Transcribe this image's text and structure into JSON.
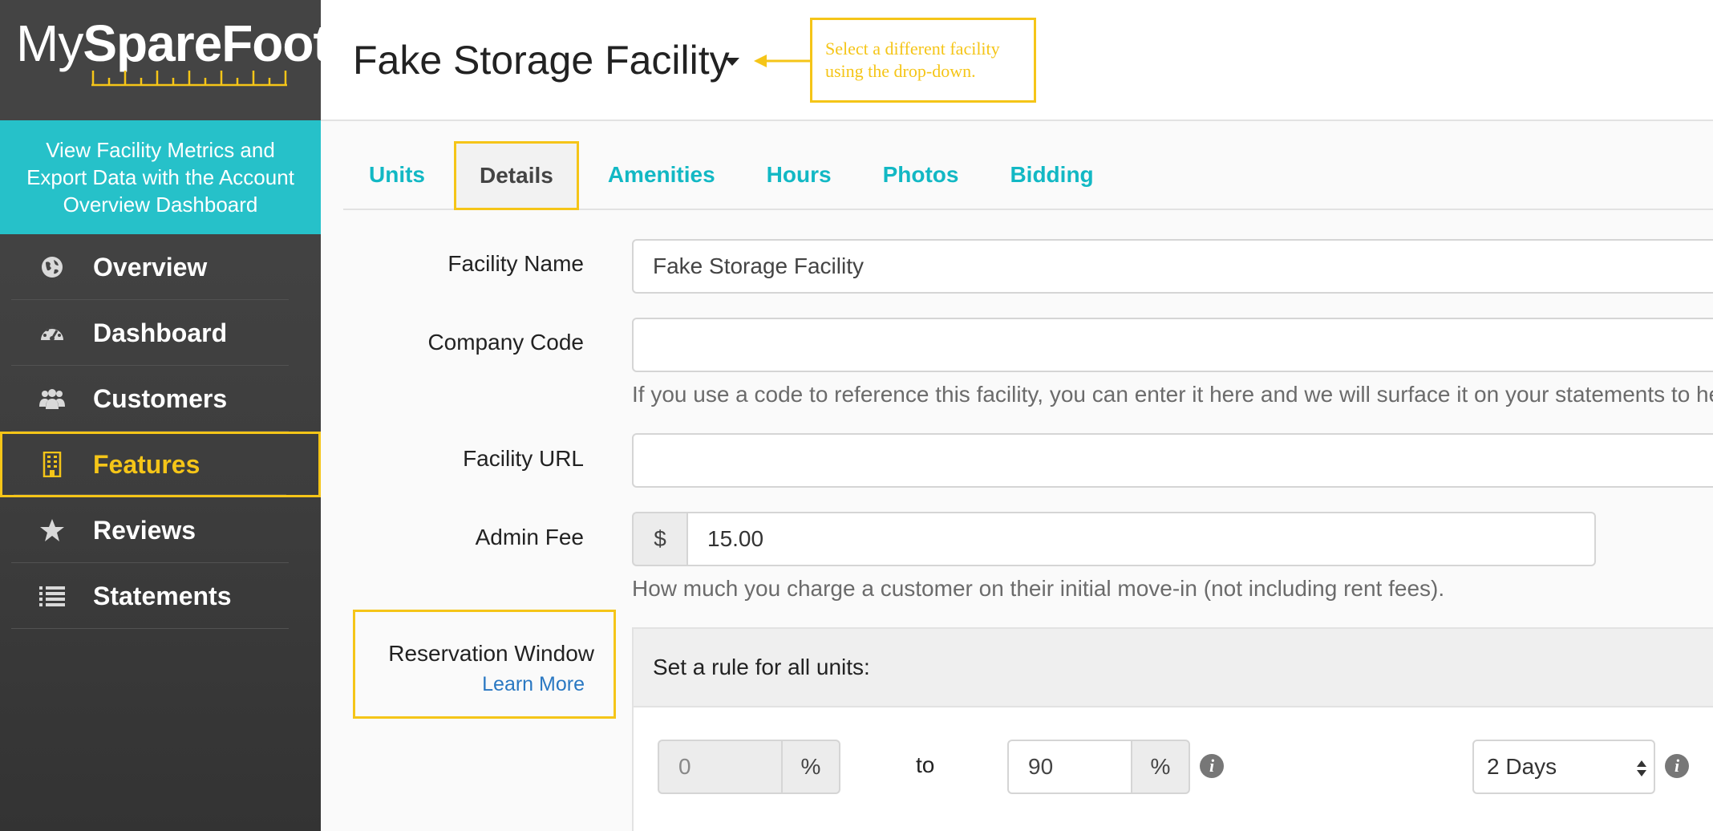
{
  "logo": {
    "my": "My",
    "brand": "SpareFoot"
  },
  "promo": {
    "text": "View Facility Metrics and Export Data with the Account Overview Dashboard"
  },
  "nav": {
    "items": [
      {
        "label": "Overview",
        "icon": "globe-icon"
      },
      {
        "label": "Dashboard",
        "icon": "speedometer-icon"
      },
      {
        "label": "Customers",
        "icon": "users-icon"
      },
      {
        "label": "Features",
        "icon": "building-icon",
        "active": true
      },
      {
        "label": "Reviews",
        "icon": "star-icon"
      },
      {
        "label": "Statements",
        "icon": "list-icon"
      }
    ]
  },
  "header": {
    "title": "Fake Storage Facility",
    "callout": "Select a different facility using the drop-down."
  },
  "tabs": [
    {
      "label": "Units"
    },
    {
      "label": "Details",
      "active": true
    },
    {
      "label": "Amenities"
    },
    {
      "label": "Hours"
    },
    {
      "label": "Photos"
    },
    {
      "label": "Bidding"
    }
  ],
  "form": {
    "facility_name": {
      "label": "Facility Name",
      "value": "Fake Storage Facility"
    },
    "company_code": {
      "label": "Company Code",
      "value": "",
      "help": "If you use a code to reference this facility, you can enter it here and we will surface it on your statements to help"
    },
    "facility_url": {
      "label": "Facility URL",
      "value": ""
    },
    "admin_fee": {
      "label": "Admin Fee",
      "currency": "$",
      "value": "15.00",
      "help": "How much you charge a customer on their initial move-in (not including rent fees)."
    },
    "reservation_window": {
      "label": "Reservation Window",
      "learn_more": "Learn More",
      "rule_heading": "Set a rule for all units:",
      "from_value": "0",
      "percent": "%",
      "to": "to",
      "to_value": "90",
      "days": "2 Days",
      "info": "i"
    }
  },
  "colors": {
    "accent": "#26c1c9",
    "tab_link": "#12b8c4",
    "highlight": "#f5c518",
    "sidebar": "#444444",
    "link": "#2a78c2"
  }
}
